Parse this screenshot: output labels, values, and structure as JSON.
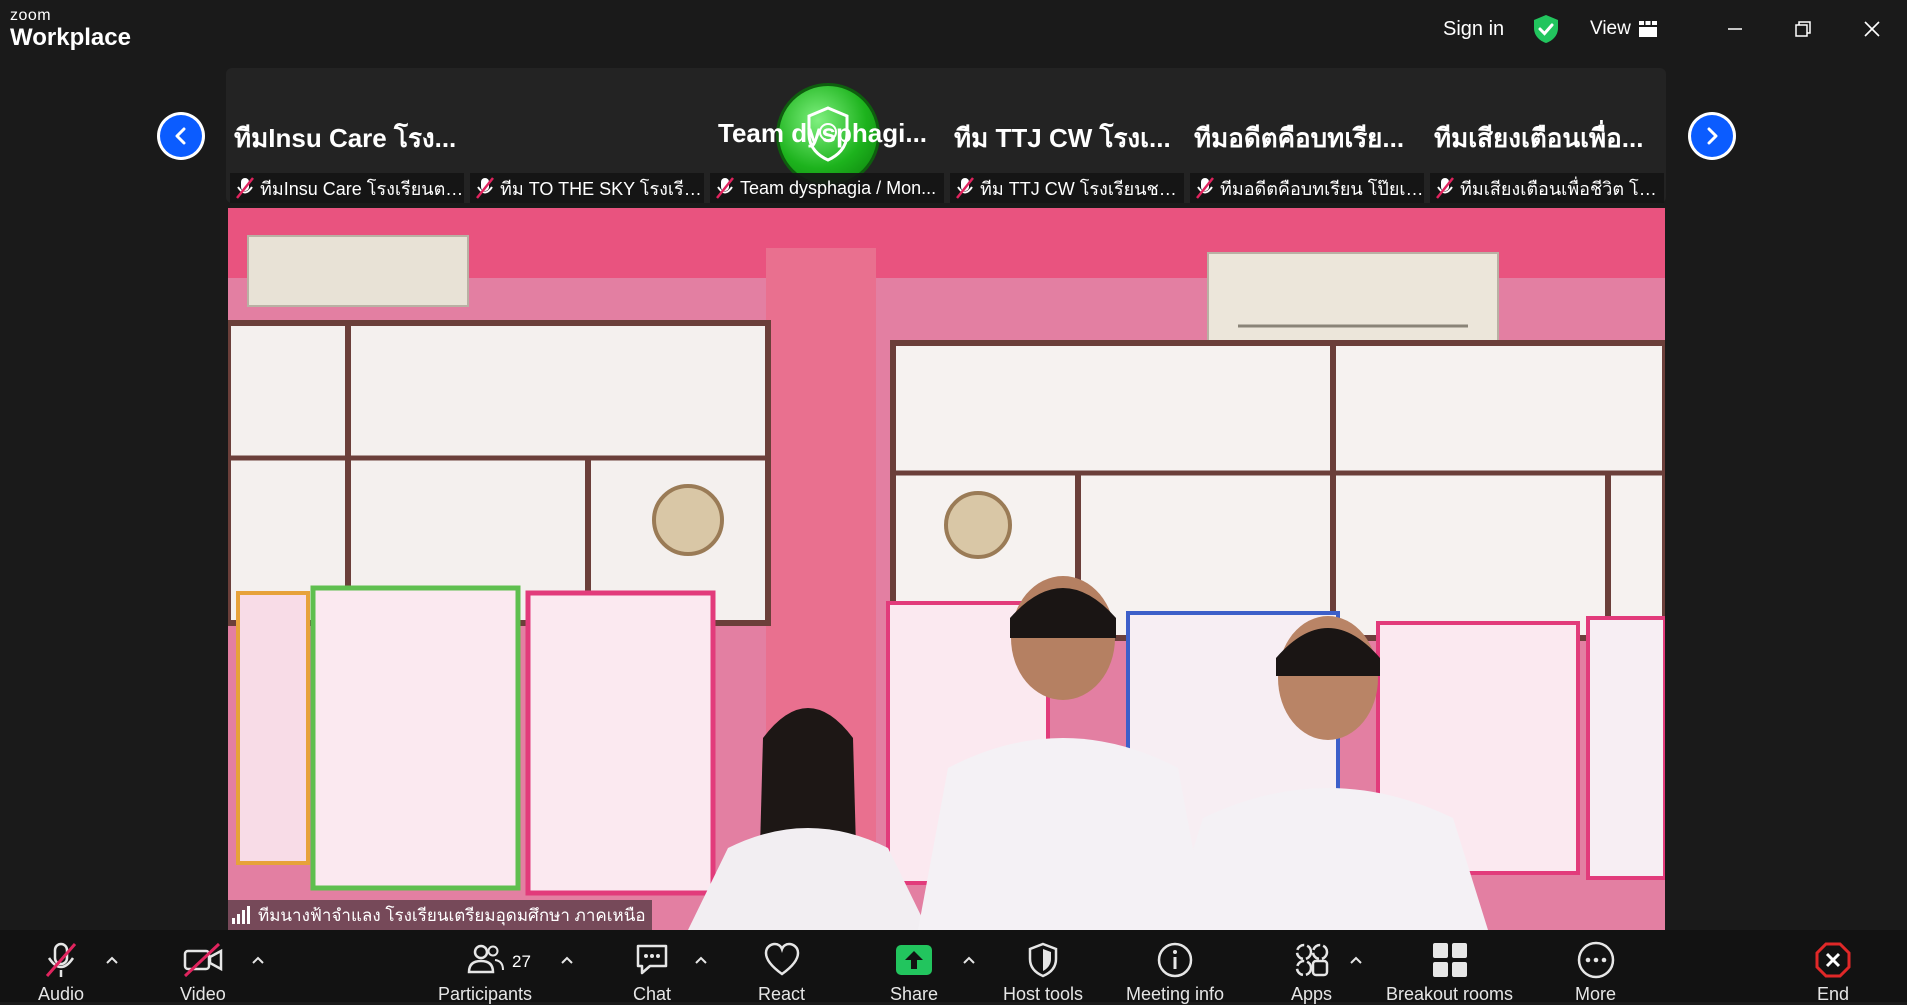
{
  "app": {
    "logo_small": "zoom",
    "logo_big": "Workplace"
  },
  "titlebar": {
    "sign_in": "Sign in",
    "view": "View"
  },
  "gallery": {
    "tiles": [
      {
        "name": "ทีมInsu Care โรง...",
        "label": "ทีมInsu Care โรงเรียนตา..."
      },
      {
        "name": "",
        "label": "ทีม TO THE SKY โรงเรียน..."
      },
      {
        "name": "Team dysphagi...",
        "label": "Team dysphagia / Mon..."
      },
      {
        "name": "ทีม TTJ CW โรงเ...",
        "label": "ทีม TTJ CW โรงเรียนชาติ..."
      },
      {
        "name": "ทีมอดีตคือบทเรีย...",
        "label": "ทีมอดีตคือบทเรียน โป๊ยเซี..."
      },
      {
        "name": "ทีมเสียงเตือนเพื่อ...",
        "label": "ทีมเสียงเตือนเพื่อชีวิต โรงเรี..."
      }
    ]
  },
  "speaker": {
    "name": "ทีมนางฟ้าจำแลง โรงเรียนเตรียมอุดมศึกษา ภาคเหนือ"
  },
  "toolbar": {
    "audio": "Audio",
    "video": "Video",
    "participants": "Participants",
    "participants_count": "27",
    "chat": "Chat",
    "react": "React",
    "share": "Share",
    "host_tools": "Host tools",
    "meeting_info": "Meeting info",
    "apps": "Apps",
    "breakout_rooms": "Breakout rooms",
    "more": "More",
    "end": "End"
  },
  "colors": {
    "accent": "#0b5cff",
    "share": "#22c55e",
    "end": "#e02828",
    "muted": "#e0245e",
    "secure": "#22c55e"
  }
}
